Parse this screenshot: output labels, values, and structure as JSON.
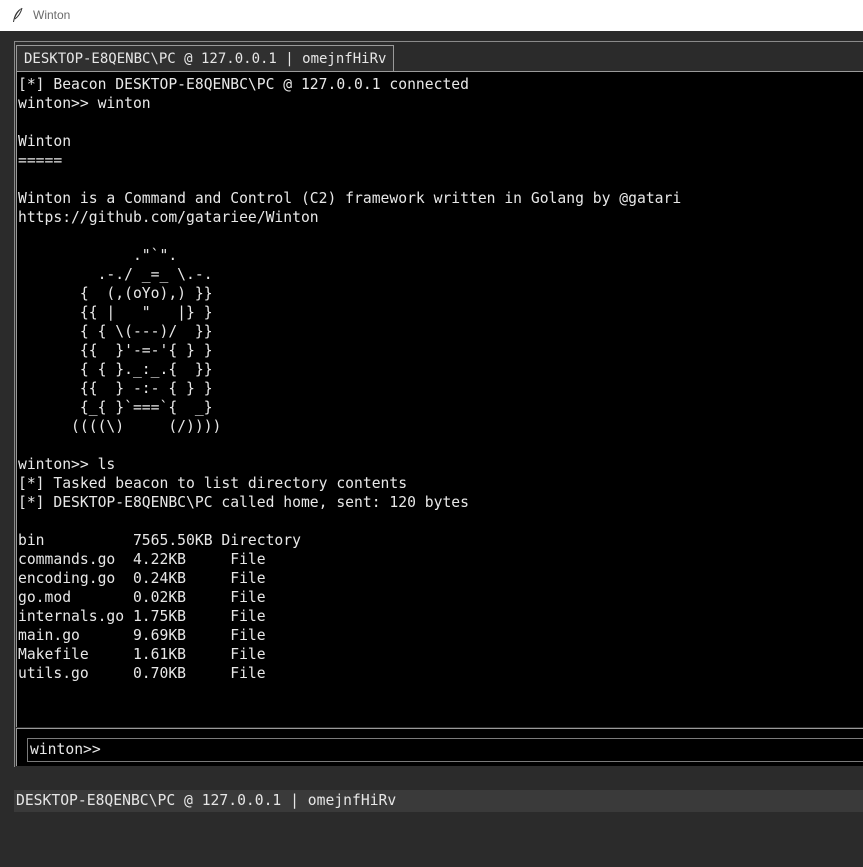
{
  "window": {
    "title": "Winton",
    "app_icon": "feather-icon"
  },
  "session_tab": {
    "label": "DESKTOP-E8QENBC\\PC @ 127.0.0.1 | omejnfHiRv"
  },
  "console": {
    "lines": [
      "[*] Beacon DESKTOP-E8QENBC\\PC @ 127.0.0.1 connected",
      "winton>> winton",
      "",
      "Winton",
      "=====",
      "",
      "Winton is a Command and Control (C2) framework written in Golang by @gatari",
      "https://github.com/gatariee/Winton",
      "",
      "             .\"`\".",
      "         .-./ _=_ \\.-.",
      "       {  (,(oYo),) }}",
      "       {{ |   \"   |} }",
      "       { { \\(---)/  }}",
      "       {{  }'-=-'{ } }",
      "       { { }._:_.{  }}",
      "       {{  } -:- { } }",
      "       {_{ }`===`{  _}",
      "      ((((\\)     (/))))",
      "",
      "winton>> ls",
      "[*] Tasked beacon to list directory contents",
      "[*] DESKTOP-E8QENBC\\PC called home, sent: 120 bytes",
      "",
      "bin          7565.50KB Directory",
      "commands.go  4.22KB     File",
      "encoding.go  0.24KB     File",
      "go.mod       0.02KB     File",
      "internals.go 1.75KB     File",
      "main.go      9.69KB     File",
      "Makefile     1.61KB     File",
      "utils.go     0.70KB     File"
    ]
  },
  "input": {
    "prompt": "winton>>"
  },
  "second_session": {
    "label": "DESKTOP-E8QENBC\\PC @ 127.0.0.1 | omejnfHiRv"
  }
}
